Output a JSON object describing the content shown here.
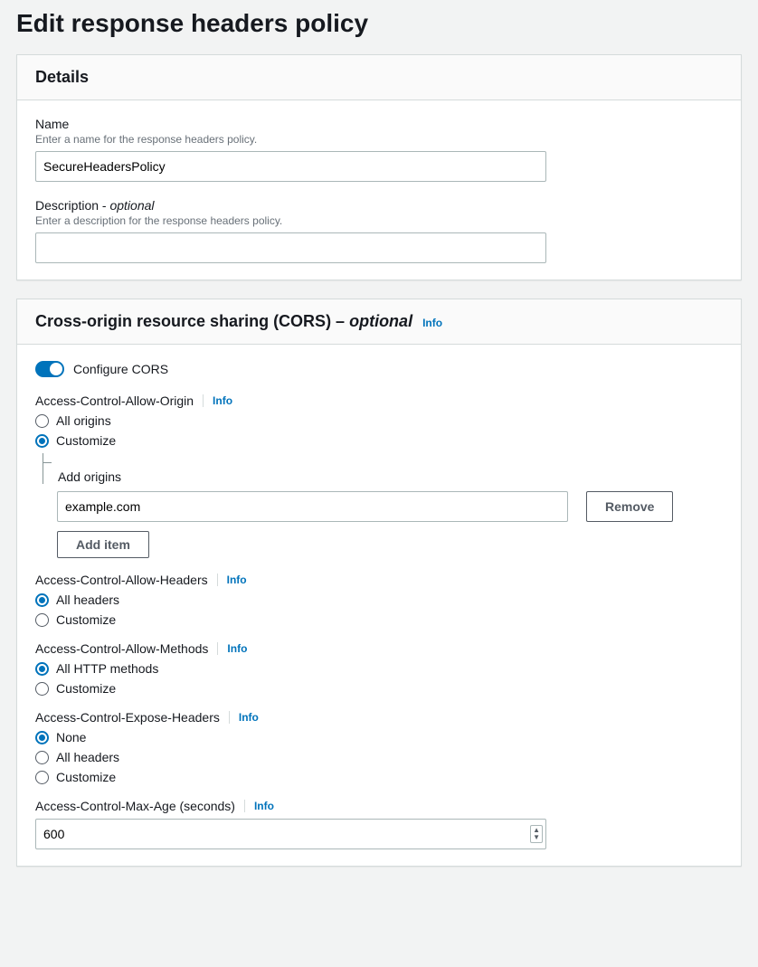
{
  "page": {
    "title": "Edit response headers policy"
  },
  "details": {
    "heading": "Details",
    "name": {
      "label": "Name",
      "hint": "Enter a name for the response headers policy.",
      "value": "SecureHeadersPolicy"
    },
    "description": {
      "label": "Description - ",
      "optional": "optional",
      "hint": "Enter a description for the response headers policy.",
      "value": ""
    }
  },
  "cors": {
    "heading": "Cross-origin resource sharing (CORS) – ",
    "heading_optional": "optional",
    "info_label": "Info",
    "toggle_label": "Configure CORS",
    "toggle_on": true,
    "allow_origin": {
      "title": "Access-Control-Allow-Origin",
      "options": {
        "all": "All origins",
        "customize": "Customize"
      },
      "selected": "customize",
      "add_origins_label": "Add origins",
      "origin_value": "example.com",
      "remove_label": "Remove",
      "add_item_label": "Add item"
    },
    "allow_headers": {
      "title": "Access-Control-Allow-Headers",
      "options": {
        "all": "All headers",
        "customize": "Customize"
      },
      "selected": "all"
    },
    "allow_methods": {
      "title": "Access-Control-Allow-Methods",
      "options": {
        "all": "All HTTP methods",
        "customize": "Customize"
      },
      "selected": "all"
    },
    "expose_headers": {
      "title": "Access-Control-Expose-Headers",
      "options": {
        "none": "None",
        "all": "All headers",
        "customize": "Customize"
      },
      "selected": "none"
    },
    "max_age": {
      "title": "Access-Control-Max-Age (seconds)",
      "value": "600"
    }
  }
}
